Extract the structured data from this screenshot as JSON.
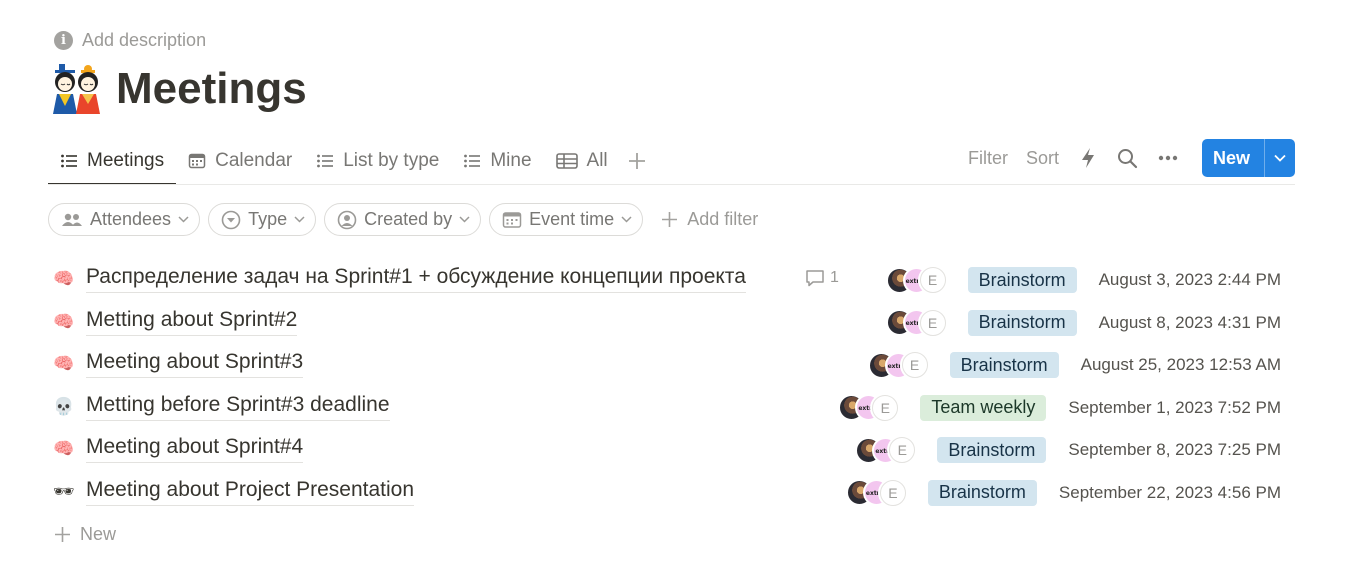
{
  "description_placeholder": "Add description",
  "page_icon": "doll-emoji-icon",
  "page_title": "Meetings",
  "tabs": [
    {
      "label": "Meetings",
      "icon": "list-icon",
      "active": true
    },
    {
      "label": "Calendar",
      "icon": "calendar-icon",
      "active": false
    },
    {
      "label": "List by type",
      "icon": "list-icon",
      "active": false
    },
    {
      "label": "Mine",
      "icon": "list-icon",
      "active": false
    },
    {
      "label": "All",
      "icon": "table-icon",
      "active": false
    }
  ],
  "toolbar": {
    "filter_label": "Filter",
    "sort_label": "Sort",
    "new_label": "New"
  },
  "filters": [
    {
      "label": "Attendees",
      "icon": "people-icon"
    },
    {
      "label": "Type",
      "icon": "circle-chevron-icon"
    },
    {
      "label": "Created by",
      "icon": "person-circle-icon"
    },
    {
      "label": "Event time",
      "icon": "calendar-icon"
    }
  ],
  "add_filter_label": "Add filter",
  "rows": [
    {
      "emoji": "🧠",
      "title": "Распределение задач на Sprint#1 + обсуждение концепции проекта",
      "comments": "1",
      "type": "Brainstorm",
      "date": "August 3, 2023 2:44 PM"
    },
    {
      "emoji": "🧠",
      "title": "Metting about Sprint#2",
      "comments": "",
      "type": "Brainstorm",
      "date": "August 8, 2023 4:31 PM"
    },
    {
      "emoji": "🧠",
      "title": "Meeting about Sprint#3",
      "comments": "",
      "type": "Brainstorm",
      "date": "August 25, 2023 12:53 AM"
    },
    {
      "emoji": "💀",
      "title": "Metting before Sprint#3 deadline",
      "comments": "",
      "type": "Team weekly",
      "date": "September 1, 2023 7:52 PM"
    },
    {
      "emoji": "🧠",
      "title": "Meeting about Sprint#4",
      "comments": "",
      "type": "Brainstorm",
      "date": "September 8, 2023 7:25 PM"
    },
    {
      "emoji": "🕶",
      "title": "Meeting about Project Presentation",
      "comments": "",
      "type": "Brainstorm",
      "date": "September 22, 2023 4:56 PM"
    }
  ],
  "avatar_initial": "E",
  "avatar_badge_text": "extract",
  "new_row_label": "New",
  "colors": {
    "accent": "#2383e2",
    "brainstorm_bg": "#d3e5ef",
    "team_weekly_bg": "#dbeddb"
  }
}
